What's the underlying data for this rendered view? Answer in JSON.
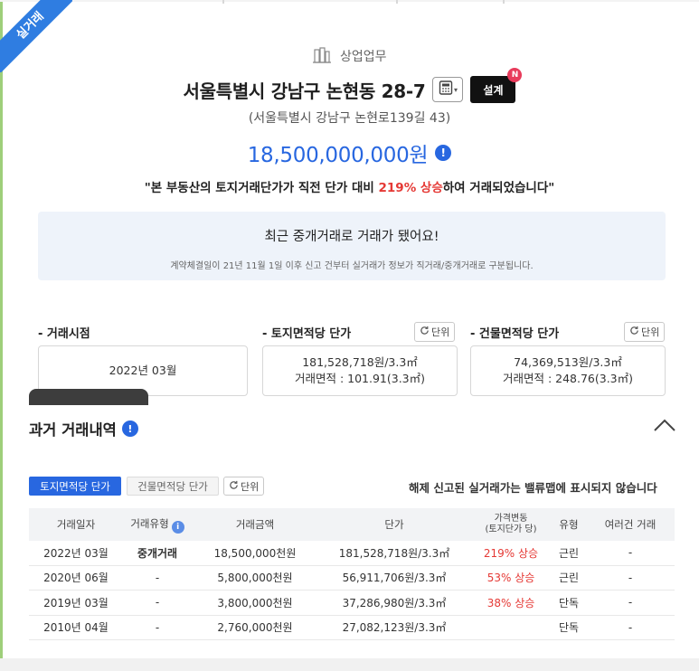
{
  "ribbon": {
    "label": "실거래"
  },
  "property": {
    "type_label": "상업업무",
    "address": "서울특별시 강남구 논현동 28-7",
    "design_label": "설계",
    "new_badge": "N",
    "road_address": "(서울특별시 강남구 논현로139길 43)",
    "price": "18,500,000,000원",
    "quote_pre": "\"본 부동산의 토지거래단가가 직전 단가 대비",
    "quote_highlight": "219% 상승",
    "quote_post": "하여 거래되었습니다\""
  },
  "notice": {
    "title": "최근 중개거래로 거래가 됐어요!",
    "desc": "계약체결일이 21년 11월 1일 이후 신고 건부터 실거래가 정보가 직거래/중개거래로 구분됩니다."
  },
  "stats": {
    "unit_label": "단위",
    "trade_time": {
      "label": "- 거래시점",
      "value": "2022년 03월"
    },
    "land_unit": {
      "label": "- 토지면적당 단가",
      "line1": "181,528,718원/3.3㎡",
      "line2": "거래면적 : 101.91(3.3㎡)"
    },
    "building_unit": {
      "label": "- 건물면적당 단가",
      "line1": "74,369,513원/3.3㎡",
      "line2": "거래면적 : 248.76(3.3㎡)"
    }
  },
  "history": {
    "title": "과거 거래내역",
    "tabs": [
      "토지면적당 단가",
      "건물면적당 단가"
    ],
    "unit_label": "단위",
    "notice": "해제 신고된 실거래가는 밸류맵에 표시되지 않습니다",
    "columns": [
      "거래일자",
      "거래유형",
      "거래금액",
      "단가",
      "가격변동",
      "(토지단가 당)",
      "유형",
      "여러건 거래"
    ],
    "rows": [
      {
        "date": "2022년 03월",
        "deal_type": "중개거래",
        "amount": "18,500,000천원",
        "unit_price": "181,528,718원/3.3㎡",
        "change": "219% 상승",
        "kind": "근린",
        "multi": "-"
      },
      {
        "date": "2020년 06월",
        "deal_type": "-",
        "amount": "5,800,000천원",
        "unit_price": "56,911,706원/3.3㎡",
        "change": "53% 상승",
        "kind": "근린",
        "multi": "-"
      },
      {
        "date": "2019년 03월",
        "deal_type": "-",
        "amount": "3,800,000천원",
        "unit_price": "37,286,980원/3.3㎡",
        "change": "38% 상승",
        "kind": "단독",
        "multi": "-"
      },
      {
        "date": "2010년 04월",
        "deal_type": "-",
        "amount": "2,760,000천원",
        "unit_price": "27,082,123원/3.3㎡",
        "change": "",
        "kind": "단독",
        "multi": "-"
      }
    ]
  },
  "colors": {
    "accent": "#2867e0",
    "increase": "#e53935",
    "ribbon": "#2f7de1",
    "notice_bg": "#eef3fa"
  }
}
